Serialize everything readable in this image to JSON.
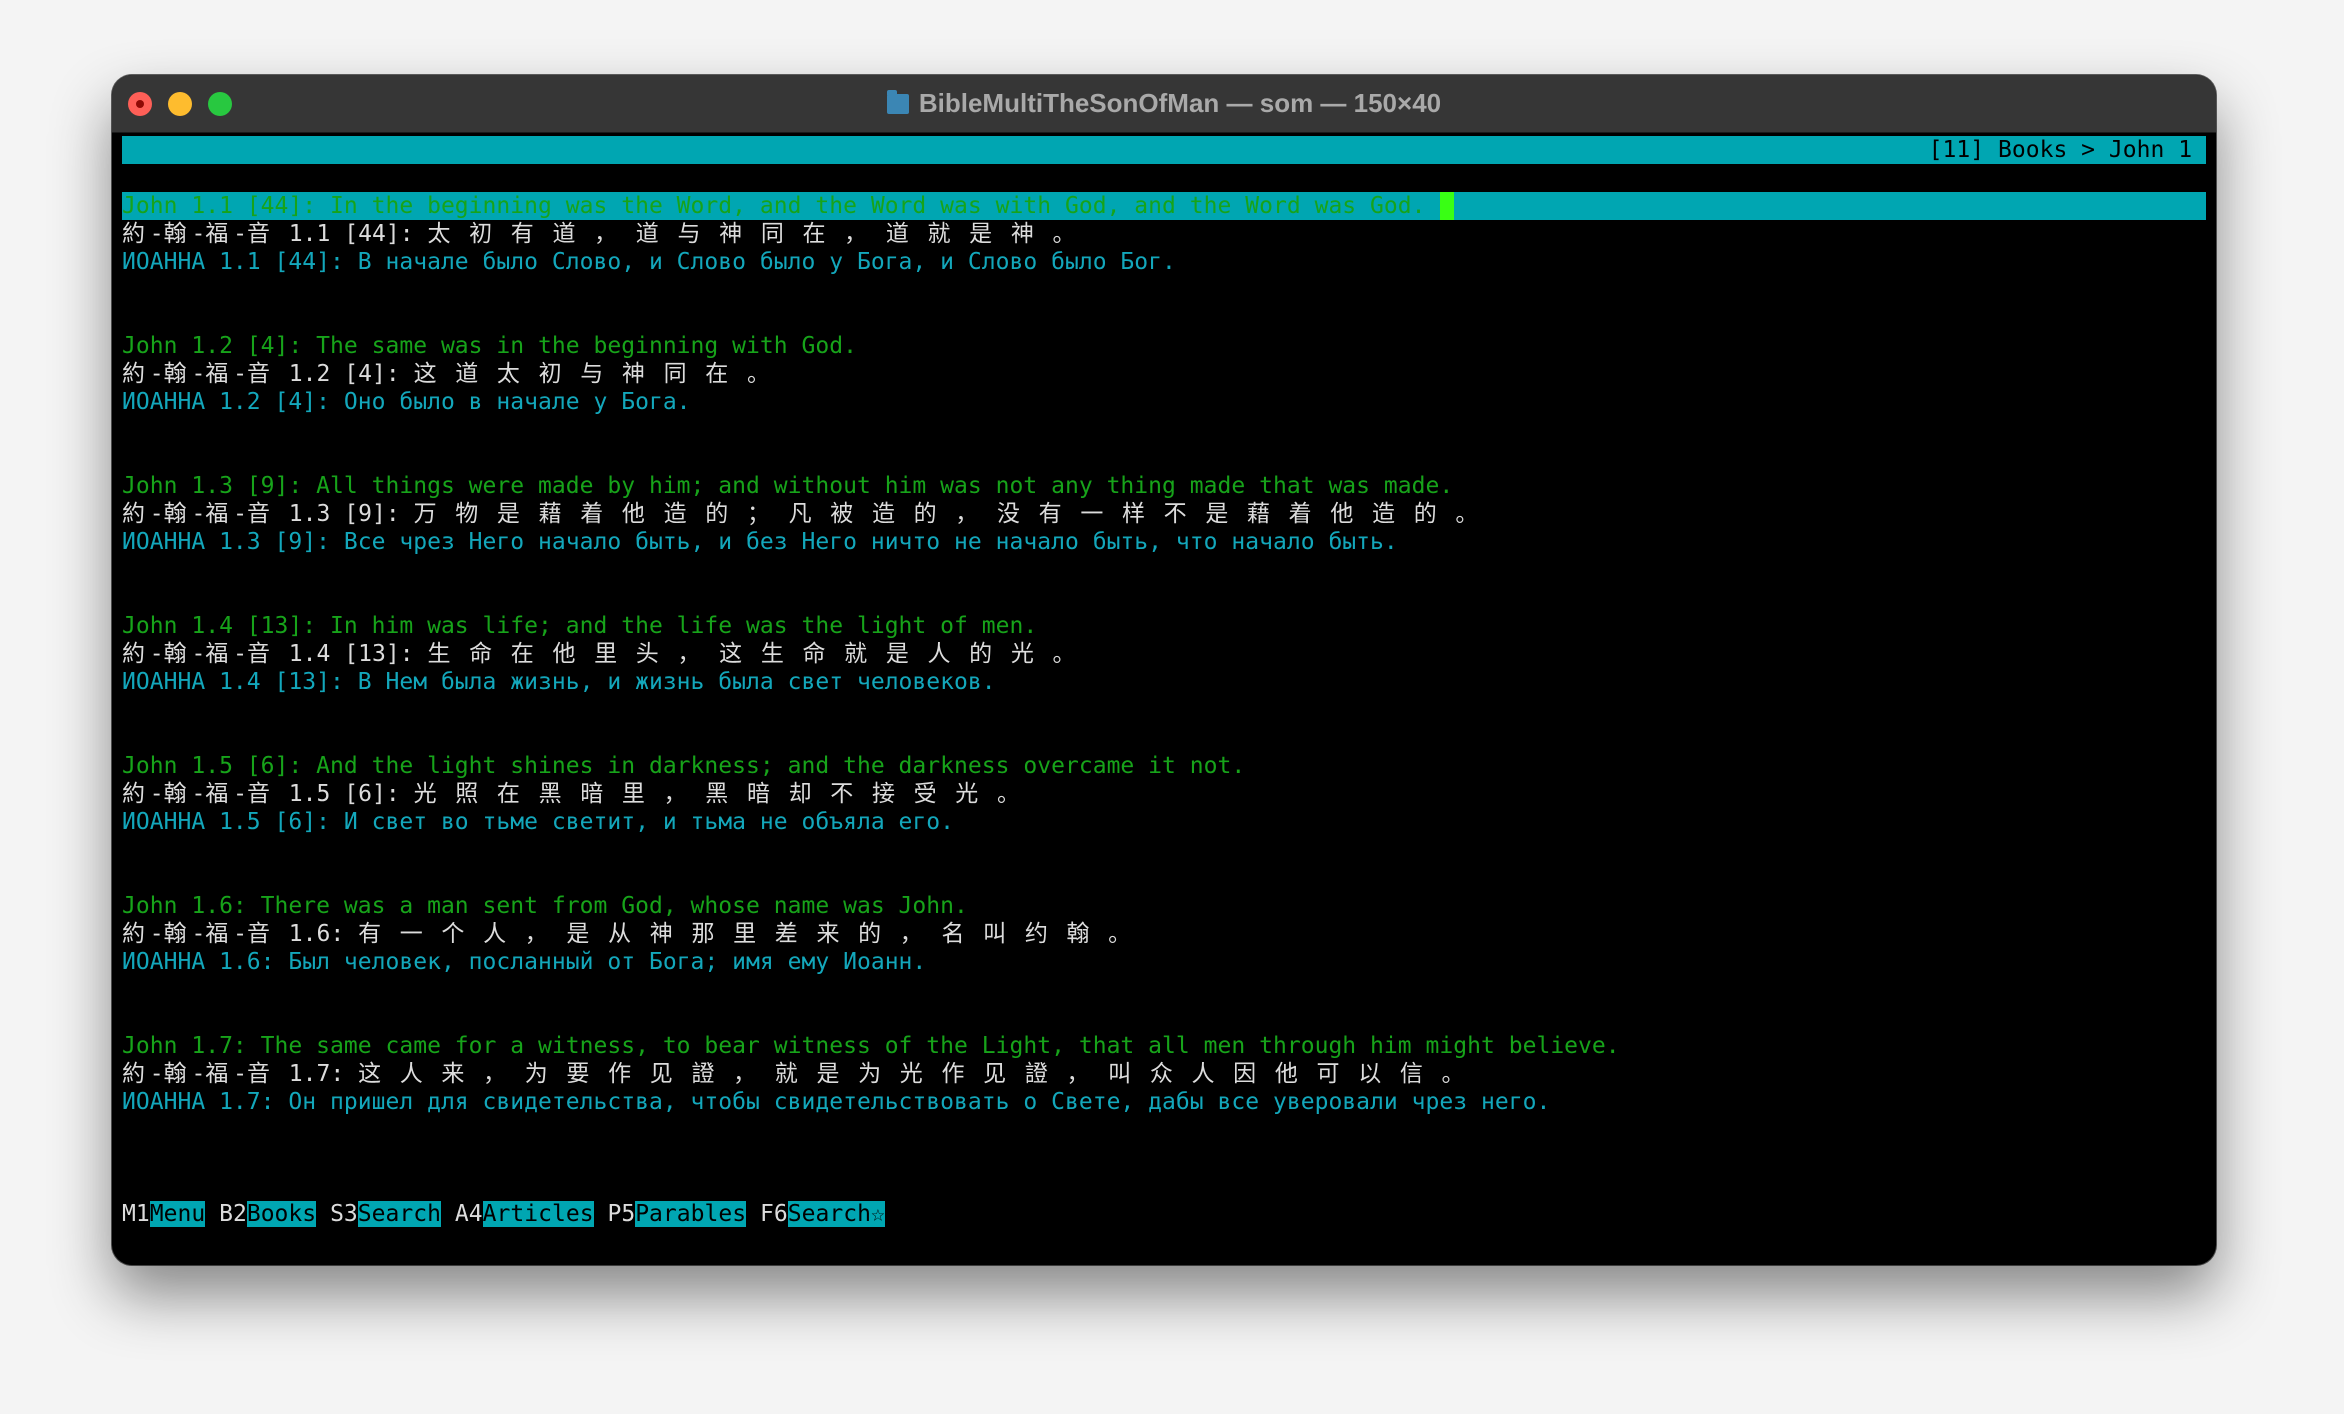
{
  "window": {
    "title": "BibleMultiTheSonOfMan — som — 150×40",
    "folder_icon": "folder-icon"
  },
  "header": {
    "breadcrumb": "[11] Books > John 1"
  },
  "verses": [
    {
      "en": "John 1.1 [44]: In the beginning was the Word, and the Word was with God, and the Word was God.",
      "zh": "約-翰-福-音 1.1 [44]: 太 初 有 道 ， 道 与 神 同 在 ， 道 就 是 神 。",
      "ru": "ИОАННА 1.1 [44]: В начале было Слово, и Слово было у Бога, и Слово было Бог.",
      "selected": true
    },
    {
      "en": "John 1.2 [4]: The same was in the beginning with God.",
      "zh": "約-翰-福-音 1.2 [4]: 这 道 太 初 与 神 同 在 。",
      "ru": "ИОАННА 1.2 [4]: Оно было в начале у Бога.",
      "selected": false
    },
    {
      "en": "John 1.3 [9]: All things were made by him; and without him was not any thing made that was made.",
      "zh": "約-翰-福-音 1.3 [9]: 万 物 是 藉 着 他 造 的 ； 凡 被 造 的 ， 没 有 一 样 不 是 藉 着 他 造 的 。",
      "ru": "ИОАННА 1.3 [9]: Все чрез Него начало быть, и без Него ничто не начало быть, что начало быть.",
      "selected": false
    },
    {
      "en": "John 1.4 [13]: In him was life; and the life was the light of men.",
      "zh": "約-翰-福-音 1.4 [13]: 生 命 在 他 里 头 ， 这 生 命 就 是 人 的 光 。",
      "ru": "ИОАННА 1.4 [13]: В Нем была жизнь, и жизнь была свет человеков.",
      "selected": false
    },
    {
      "en": "John 1.5 [6]: And the light shines in darkness; and the darkness overcame it not.",
      "zh": "約-翰-福-音 1.5 [6]: 光 照 在 黑 暗 里 ， 黑 暗 却 不 接 受 光 。",
      "ru": "ИОАННА 1.5 [6]: И свет во тьме светит, и тьма не объяла его.",
      "selected": false
    },
    {
      "en": "John 1.6: There was a man sent from God, whose name was John.",
      "zh": "約-翰-福-音 1.6: 有 一 个 人 ， 是 从 神 那 里 差 来 的 ， 名 叫 约 翰 。",
      "ru": "ИОАННА 1.6: Был человек, посланный от Бога; имя ему Иоанн.",
      "selected": false
    },
    {
      "en": "John 1.7: The same came for a witness, to bear witness of the Light, that all men through him might believe.",
      "zh": "約-翰-福-音 1.7: 这 人 来 ， 为 要 作 见 證 ， 就 是 为 光 作 见 證 ， 叫 众 人 因 他 可 以 信 。",
      "ru": "ИОАННА 1.7: Он пришел для свидетельства, чтобы свидетельствовать о Свете, дабы все уверовали чрез него.",
      "selected": false
    }
  ],
  "menu": [
    {
      "key": "M1",
      "label": "Menu"
    },
    {
      "key": "B2",
      "label": "Books"
    },
    {
      "key": "S3",
      "label": "Search"
    },
    {
      "key": "A4",
      "label": "Articles"
    },
    {
      "key": "P5",
      "label": "Parables"
    },
    {
      "key": "F6",
      "label": "Search☆"
    }
  ],
  "colors": {
    "accent_teal": "#00a6b2",
    "english_green": "#17a31a",
    "chinese_white": "#dcdcdc",
    "russian_cyan": "#13a7bb",
    "cursor_green": "#39ff14"
  }
}
